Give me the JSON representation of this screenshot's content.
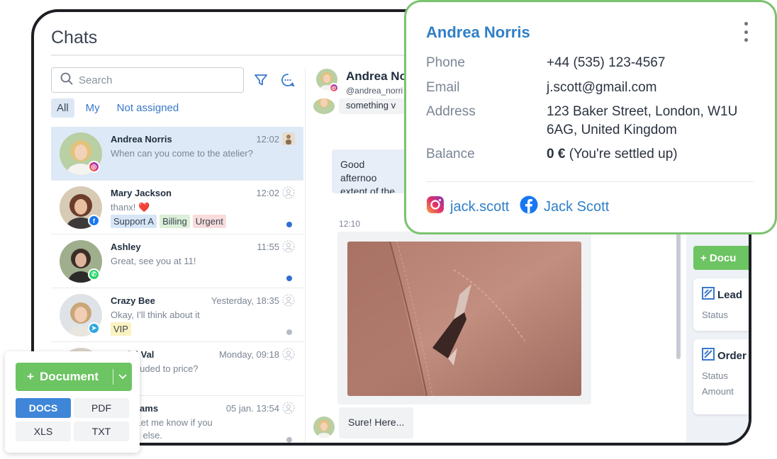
{
  "app": {
    "title": "Chats"
  },
  "search": {
    "placeholder": "Search"
  },
  "filters": [
    {
      "label": "All",
      "active": true
    },
    {
      "label": "My",
      "active": false
    },
    {
      "label": "Not assigned",
      "active": false
    }
  ],
  "chats": [
    {
      "name": "Andrea Norris",
      "time": "12:02",
      "preview": "When can you come to the atelier?",
      "channel": "instagram",
      "selected": true,
      "tags": [],
      "unread": ""
    },
    {
      "name": "Mary Jackson",
      "time": "12:02",
      "preview": "thanx! ❤️",
      "channel": "facebook",
      "selected": false,
      "tags": [
        "Support A",
        "Billing",
        "Urgent"
      ],
      "unread": "blue"
    },
    {
      "name": "Ashley",
      "time": "11:55",
      "preview": "Great, see you at 11!",
      "channel": "whatsapp",
      "selected": false,
      "tags": [],
      "unread": "blue"
    },
    {
      "name": "Crazy Bee",
      "time": "Yesterday, 18:35",
      "preview": "Okay, I'll think about it",
      "channel": "telegram",
      "selected": false,
      "tags": [
        "VIP"
      ],
      "unread": "grey"
    },
    {
      "name": "Daniel Val",
      "time": "Monday, 09:18",
      "preview": "ery included to price?",
      "channel": "",
      "selected": false,
      "tags": [
        "t"
      ],
      "unread": ""
    },
    {
      "name": "el Williams",
      "time": "05 jan. 13:54",
      "preview": "r this! Let me know if you",
      "preview2": "nything else.",
      "channel": "",
      "selected": false,
      "tags": [],
      "unread": "grey"
    }
  ],
  "tag_colors": {
    "Support A": "#d6e6f7",
    "Billing": "#dcefd9",
    "Urgent": "#f8dcdc",
    "VIP": "#fbf2c2",
    "t": "#f8dcdc"
  },
  "conversation": {
    "header_name": "Andrea No",
    "header_handle": "@andrea_norri",
    "top_snippet": "something v",
    "greeting_line1": "Good afternoo",
    "greeting_line2": "extent of the p",
    "photo_time": "12:10",
    "reply": "Sure! Here..."
  },
  "crm": {
    "doc_button": "+ Docu",
    "lead_title": "Lead",
    "lead_status_label": "Status",
    "order_title": "Order",
    "order_status_label": "Status",
    "order_amount_label": "Amount"
  },
  "contact": {
    "name": "Andrea Norris",
    "phone_label": "Phone",
    "phone": "+44 (535) 123-4567",
    "email_label": "Email",
    "email": "j.scott@gmail.com",
    "address_label": "Address",
    "address_line1": "123 Baker Street, London, W1U",
    "address_line2": "6AG, United Kingdom",
    "balance_label": "Balance",
    "balance_amount": "0 €",
    "balance_note": " (You're settled up)",
    "instagram": "jack.scott",
    "facebook": "Jack Scott"
  },
  "document_widget": {
    "button_label": "Document",
    "formats": [
      {
        "label": "DOCS",
        "active": true
      },
      {
        "label": "PDF",
        "active": false
      },
      {
        "label": "XLS",
        "active": false
      },
      {
        "label": "TXT",
        "active": false
      }
    ]
  },
  "colors": {
    "accent_green": "#6cc462",
    "popup_border": "#7bc36f",
    "link_blue": "#2f7fc7",
    "selected_row": "#dde9f6",
    "active_format": "#3f86d8"
  }
}
